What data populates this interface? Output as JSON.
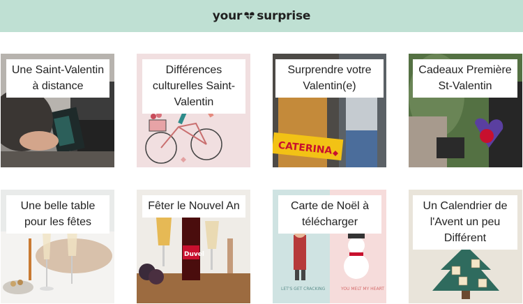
{
  "header": {
    "logo_left": "your",
    "logo_right": "surprise",
    "background": "#bfe0d3"
  },
  "cards": [
    {
      "title": "Une Saint-Valentin à distance"
    },
    {
      "title": "Différences culturelles Saint-Valentin"
    },
    {
      "title": "Surprendre votre Valentin(e)",
      "photo_text": "CATERINA"
    },
    {
      "title": "Cadeaux Première St-Valentin"
    },
    {
      "title": "Une belle table pour les fêtes"
    },
    {
      "title": "Fêter le Nouvel An",
      "photo_text": "Duvel"
    },
    {
      "title": "Carte de Noël à télécharger",
      "photo_text_left": "LET'S GET CRACKING",
      "photo_text_right": "YOU MELT MY HEART"
    },
    {
      "title": "Un Calendrier de l'Avent un peu Différent"
    }
  ]
}
